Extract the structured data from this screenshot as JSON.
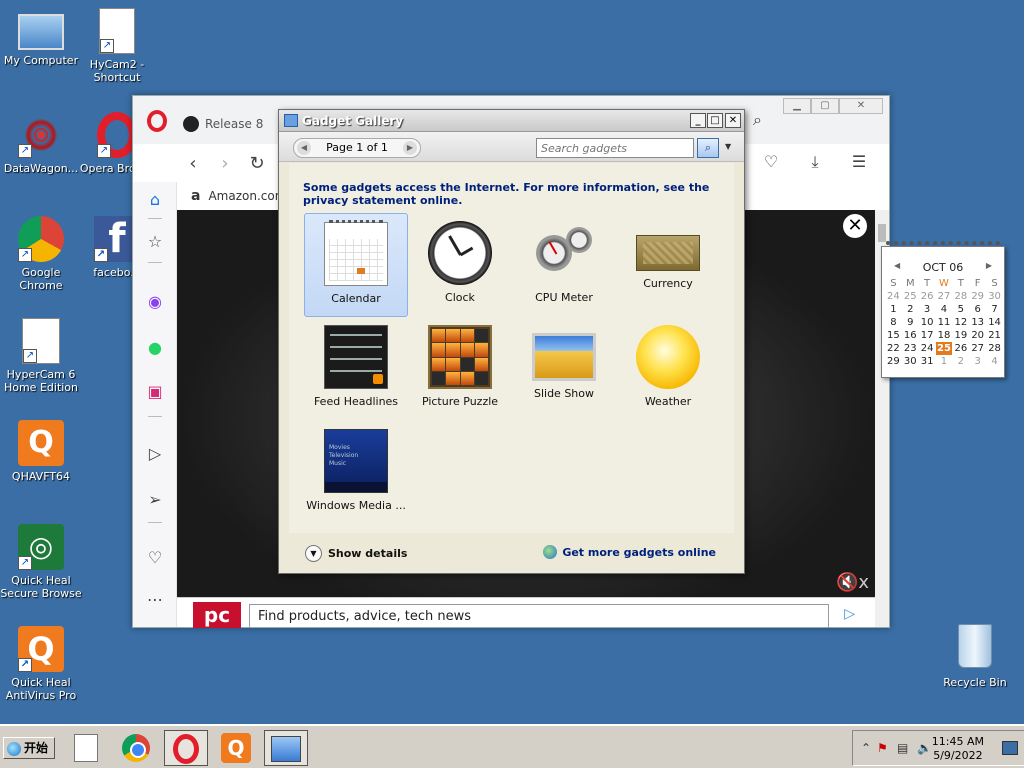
{
  "desktop": {
    "icons": [
      {
        "label": "My Computer"
      },
      {
        "label": "HyCam2 - Shortcut"
      },
      {
        "label": "DataWagon..."
      },
      {
        "label": "Opera Brow..."
      },
      {
        "label": "Google Chrome"
      },
      {
        "label": "facebo..."
      },
      {
        "label": "HyperCam 6 Home Edition"
      },
      {
        "label": "QHAVFT64"
      },
      {
        "label": "Quick Heal Secure Browse"
      },
      {
        "label": "Quick Heal AntiVirus Pro"
      }
    ],
    "recycle_bin": "Recycle Bin"
  },
  "browser": {
    "tab_label": "Release 8",
    "bookmark_label": "Amazon.com",
    "ad_search_text": "Find products, advice, tech news",
    "ad_logo_text": "pc",
    "close_label": "✕",
    "mute_label": "🔇x"
  },
  "gallery": {
    "title": "Gadget Gallery",
    "page_indicator": "Page 1 of 1",
    "search_placeholder": "Search gadgets",
    "notice": "Some gadgets access the Internet.  For more information, see the privacy statement online.",
    "gadgets": [
      {
        "label": "Calendar"
      },
      {
        "label": "Clock"
      },
      {
        "label": "CPU Meter"
      },
      {
        "label": "Currency"
      },
      {
        "label": "Feed Headlines"
      },
      {
        "label": "Picture Puzzle"
      },
      {
        "label": "Slide Show"
      },
      {
        "label": "Weather"
      },
      {
        "label": "Windows Media ..."
      }
    ],
    "wmc_lines": [
      "Movies",
      "Television",
      "Music"
    ],
    "show_details": "Show details",
    "more_gadgets": "Get more gadgets online"
  },
  "calendar_gadget": {
    "month_label": "OCT 06",
    "weekdays": [
      "S",
      "M",
      "T",
      "W",
      "T",
      "F",
      "S"
    ],
    "weeks": [
      [
        "24",
        "25",
        "26",
        "27",
        "28",
        "29",
        "30"
      ],
      [
        "1",
        "2",
        "3",
        "4",
        "5",
        "6",
        "7"
      ],
      [
        "8",
        "9",
        "10",
        "11",
        "12",
        "13",
        "14"
      ],
      [
        "15",
        "16",
        "17",
        "18",
        "19",
        "20",
        "21"
      ],
      [
        "22",
        "23",
        "24",
        "25",
        "26",
        "27",
        "28"
      ],
      [
        "29",
        "30",
        "31",
        "1",
        "2",
        "3",
        "4"
      ]
    ],
    "today": "25"
  },
  "taskbar": {
    "start_label": "开始",
    "time": "11:45 AM",
    "date": "5/9/2022"
  },
  "colors": {
    "desktop_bg": "#3a6ea5",
    "accent_orange": "#e07b20",
    "link_blue": "#00217b"
  }
}
